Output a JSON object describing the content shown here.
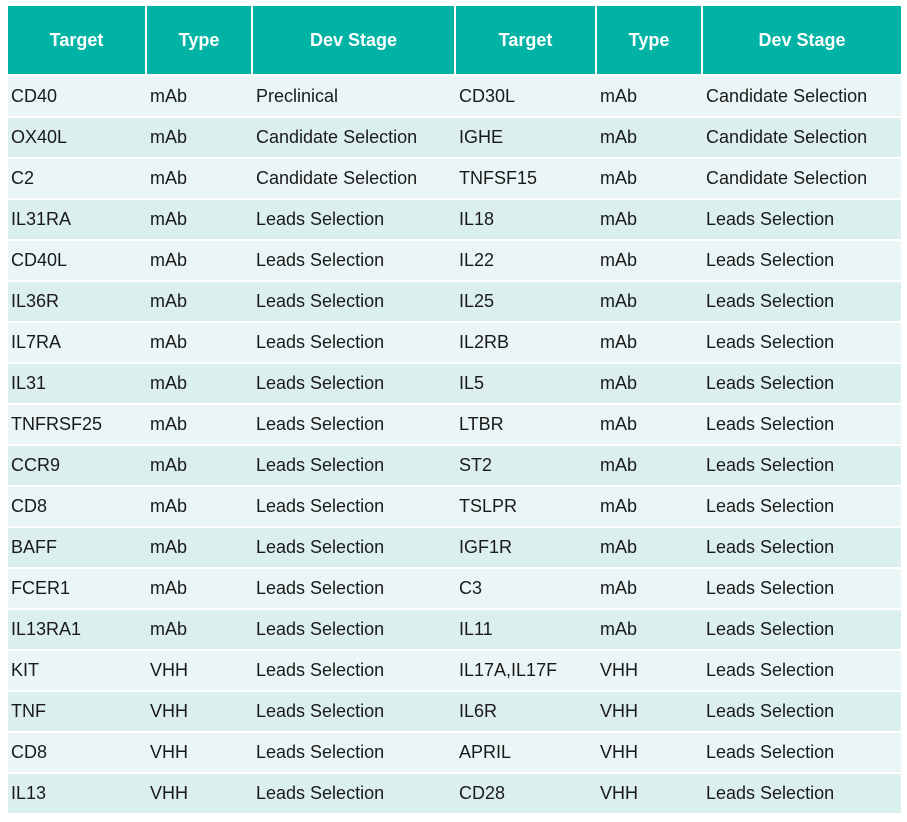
{
  "headers": [
    "Target",
    "Type",
    "Dev Stage",
    "Target",
    "Type",
    "Dev Stage"
  ],
  "rows": [
    [
      "CD40",
      "mAb",
      "Preclinical",
      "CD30L",
      "mAb",
      "Candidate Selection"
    ],
    [
      "OX40L",
      "mAb",
      "Candidate Selection",
      "IGHE",
      "mAb",
      "Candidate Selection"
    ],
    [
      "C2",
      "mAb",
      "Candidate Selection",
      "TNFSF15",
      "mAb",
      "Candidate Selection"
    ],
    [
      "IL31RA",
      "mAb",
      "Leads Selection",
      "IL18",
      "mAb",
      "Leads Selection"
    ],
    [
      "CD40L",
      "mAb",
      "Leads Selection",
      "IL22",
      "mAb",
      "Leads Selection"
    ],
    [
      "IL36R",
      "mAb",
      "Leads Selection",
      "IL25",
      "mAb",
      "Leads Selection"
    ],
    [
      "IL7RA",
      "mAb",
      "Leads Selection",
      "IL2RB",
      "mAb",
      "Leads Selection"
    ],
    [
      "IL31",
      "mAb",
      "Leads Selection",
      "IL5",
      "mAb",
      "Leads Selection"
    ],
    [
      "TNFRSF25",
      "mAb",
      "Leads Selection",
      "LTBR",
      "mAb",
      "Leads Selection"
    ],
    [
      "CCR9",
      "mAb",
      "Leads Selection",
      "ST2",
      "mAb",
      "Leads Selection"
    ],
    [
      "CD8",
      "mAb",
      "Leads Selection",
      "TSLPR",
      "mAb",
      "Leads Selection"
    ],
    [
      "BAFF",
      "mAb",
      "Leads Selection",
      "IGF1R",
      "mAb",
      "Leads Selection"
    ],
    [
      "FCER1",
      "mAb",
      "Leads Selection",
      "C3",
      "mAb",
      "Leads Selection"
    ],
    [
      "IL13RA1",
      "mAb",
      "Leads Selection",
      "IL11",
      "mAb",
      "Leads Selection"
    ],
    [
      "KIT",
      "VHH",
      "Leads Selection",
      "IL17A,IL17F",
      "VHH",
      "Leads Selection"
    ],
    [
      "TNF",
      "VHH",
      "Leads Selection",
      "IL6R",
      "VHH",
      "Leads Selection"
    ],
    [
      "CD8",
      "VHH",
      "Leads Selection",
      "APRIL",
      "VHH",
      "Leads Selection"
    ],
    [
      "IL13",
      "VHH",
      "Leads Selection",
      "CD28",
      "VHH",
      "Leads Selection"
    ]
  ],
  "colors": {
    "header_bg": "#00b3a4",
    "header_text": "#ffffff",
    "row_odd_bg": "#eaf6f6",
    "row_even_bg": "#dcefef"
  }
}
